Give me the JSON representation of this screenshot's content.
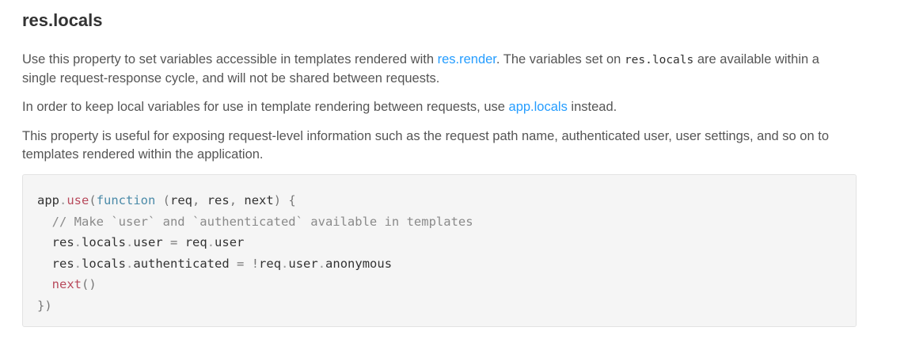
{
  "heading": "res.locals",
  "paragraphs": {
    "p1_before": "Use this property to set variables accessible in templates rendered with ",
    "p1_link": "res.render",
    "p1_middle": ". The variables set on ",
    "p1_code": "res.locals",
    "p1_after": " are available within a single request-response cycle, and will not be shared between requests.",
    "p2_before": "In order to keep local variables for use in template rendering between requests, use ",
    "p2_link": "app.locals",
    "p2_after": " instead.",
    "p3": "This property is useful for exposing request-level information such as the request path name, authenticated user, user settings, and so on to templates rendered within the application."
  },
  "code": {
    "l1": {
      "obj": "app",
      "dot": ".",
      "method": "use",
      "open": "(",
      "kw": "function",
      "args_open": " (",
      "a1": "req",
      "comma1": ", ",
      "a2": "res",
      "comma2": ", ",
      "a3": "next",
      "args_close": ") {"
    },
    "l2": "  // Make `user` and `authenticated` available in templates",
    "l3": {
      "indent": "  ",
      "a": "res",
      "d1": ".",
      "b": "locals",
      "d2": ".",
      "c": "user",
      "eq": " = ",
      "d": "req",
      "d3": ".",
      "e": "user"
    },
    "l4": {
      "indent": "  ",
      "a": "res",
      "d1": ".",
      "b": "locals",
      "d2": ".",
      "c": "authenticated",
      "eq": " = ",
      "bang": "!",
      "d": "req",
      "d3": ".",
      "e": "user",
      "d4": ".",
      "f": "anonymous"
    },
    "l5": {
      "indent": "  ",
      "method": "next",
      "parens": "()"
    },
    "l6": "})"
  },
  "colors": {
    "link": "#259dff",
    "heading": "#333333",
    "body_text": "#555555",
    "code_bg": "#f5f5f5",
    "method": "#b84a5c",
    "keyword": "#4a8aa8",
    "comment": "#8a8a8a"
  }
}
